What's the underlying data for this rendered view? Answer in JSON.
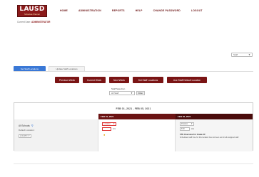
{
  "header": {
    "logo_main": "LAUSD",
    "logo_sub": "Schedule Planner",
    "nav": [
      "HOME",
      "ADMINISTRATION",
      "REPORTS",
      "HELP",
      "CHANGE PASSWORD",
      "LOGOUT"
    ]
  },
  "user": {
    "label": "Current User:",
    "name": "ADMINISTRATOR"
  },
  "top_select": {
    "value": "Staff",
    "caret": "▼"
  },
  "tabs": [
    {
      "label": "Set Staff Locations",
      "active": true
    },
    {
      "label": "Update Staff Locations",
      "active": false
    }
  ],
  "actions": [
    "Previous Week",
    "Current Week",
    "Next Week",
    "Set Staff Locations",
    "Use Staff Default Location"
  ],
  "staff_filter": {
    "label": "Staff Selection",
    "value": "All Staff",
    "caret": "▼",
    "go_label": "Filter"
  },
  "schedule": {
    "date_range": "FEB 01, 2021 - FEB 05, 2021",
    "day_headers": [
      "FEB 01, 2021",
      "FEB 02, 2021"
    ],
    "left": {
      "title": "All Schools",
      "default_label": "Default Location:",
      "default_value": "LOCATN",
      "caret": "▼"
    },
    "mon": {
      "select_value": "Location",
      "caret": "▼",
      "time_suffix": "Hrs",
      "warn_icon": "warning-icon"
    },
    "tue": {
      "select_value": "Position",
      "caret": "▼",
      "time_value": "8:00",
      "time_suffix": "Hrs",
      "note_title": "FTE Overview for Grade 1F",
      "note": "Scheduled staff time for this location has not been set for all assigned staff."
    }
  },
  "colors": {
    "brand": "#7a1414",
    "accent": "#3a78d6",
    "header_dark": "#6b1313"
  }
}
